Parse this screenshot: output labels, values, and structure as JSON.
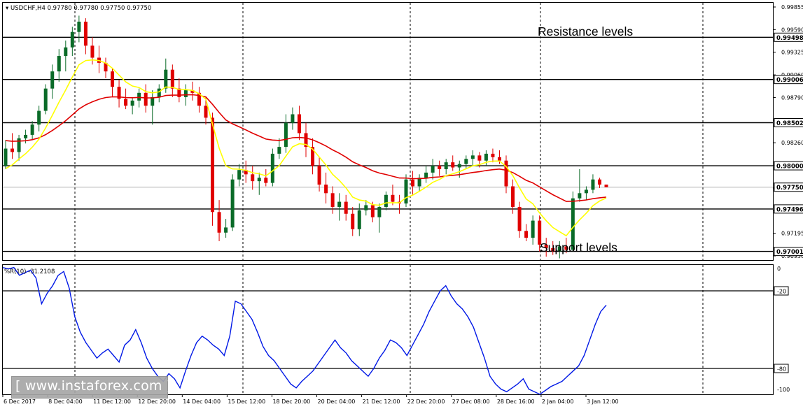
{
  "header": {
    "symbol": "USDCHF,H4",
    "open": "0.97780",
    "high": "0.97780",
    "low": "0.97750",
    "close": "0.97750"
  },
  "annotations": {
    "resistance": "Resistance levels",
    "support": "Support levels"
  },
  "watermark": "[ www.instaforex.com ]",
  "indicator": {
    "name": "%R(10)",
    "value": "-31.2108"
  },
  "colors": {
    "bull_candle": "#0a6b28",
    "bear_candle": "#e00000",
    "ma_fast": "#ffff00",
    "ma_slow": "#e00000",
    "wpr_line": "#0018e6",
    "level_line": "#000000"
  },
  "chart_data": [
    {
      "type": "candlestick",
      "instrument": "USDCHF",
      "timeframe": "H4",
      "y_ticks": [
        "0.99855",
        "0.99590",
        "0.99325",
        "0.99060",
        "0.98790",
        "0.98525",
        "0.98260",
        "0.97995",
        "0.97730",
        "0.97460",
        "0.97195",
        "0.96930"
      ],
      "ylim": [
        0.969,
        0.999
      ],
      "horizontal_levels": [
        {
          "value": 0.99498,
          "label": "0.99498"
        },
        {
          "value": 0.99006,
          "label": "0.99006"
        },
        {
          "value": 0.98502,
          "label": "0.98502"
        },
        {
          "value": 0.98,
          "label": "0.98000"
        },
        {
          "value": 0.97496,
          "label": "0.97496"
        },
        {
          "value": 0.97001,
          "label": "0.97001"
        }
      ],
      "current_price": {
        "value": 0.9775,
        "label": "0.97750"
      },
      "x_labels": [
        "6 Dec 2017",
        "8 Dec 04:00",
        "11 Dec 12:00",
        "12 Dec 20:00",
        "14 Dec 04:00",
        "15 Dec 12:00",
        "18 Dec 20:00",
        "20 Dec 04:00",
        "21 Dec 12:00",
        "22 Dec 20:00",
        "27 Dec 08:00",
        "28 Dec 16:00",
        "2 Jan 04:00",
        "3 Jan 12:00"
      ],
      "ohlc": [
        [
          0.98,
          0.983,
          0.9796,
          0.982
        ],
        [
          0.982,
          0.9838,
          0.9808,
          0.9816
        ],
        [
          0.9816,
          0.9836,
          0.9806,
          0.9832
        ],
        [
          0.9832,
          0.9842,
          0.9826,
          0.9836
        ],
        [
          0.9836,
          0.9852,
          0.983,
          0.9848
        ],
        [
          0.9848,
          0.987,
          0.984,
          0.9864
        ],
        [
          0.9864,
          0.9895,
          0.986,
          0.989
        ],
        [
          0.989,
          0.9918,
          0.9878,
          0.991
        ],
        [
          0.991,
          0.9936,
          0.9898,
          0.9928
        ],
        [
          0.9928,
          0.9946,
          0.991,
          0.9938
        ],
        [
          0.9938,
          0.9962,
          0.9928,
          0.9956
        ],
        [
          0.9956,
          0.9975,
          0.9944,
          0.9968
        ],
        [
          0.9968,
          0.9972,
          0.993,
          0.994
        ],
        [
          0.994,
          0.995,
          0.9918,
          0.9926
        ],
        [
          0.9926,
          0.994,
          0.9908,
          0.992
        ],
        [
          0.992,
          0.9926,
          0.9902,
          0.991
        ],
        [
          0.991,
          0.9914,
          0.988,
          0.9892
        ],
        [
          0.9892,
          0.99,
          0.9868,
          0.9878
        ],
        [
          0.9878,
          0.989,
          0.9866,
          0.987
        ],
        [
          0.987,
          0.988,
          0.986,
          0.9876
        ],
        [
          0.9876,
          0.989,
          0.9868,
          0.9885
        ],
        [
          0.9885,
          0.9895,
          0.9862,
          0.987
        ],
        [
          0.987,
          0.9888,
          0.9848,
          0.988
        ],
        [
          0.988,
          0.9895,
          0.9874,
          0.989
        ],
        [
          0.989,
          0.9925,
          0.9885,
          0.9912
        ],
        [
          0.9912,
          0.9918,
          0.988,
          0.989
        ],
        [
          0.989,
          0.9902,
          0.9874,
          0.988
        ],
        [
          0.988,
          0.9895,
          0.987,
          0.9888
        ],
        [
          0.9888,
          0.9898,
          0.9876,
          0.9885
        ],
        [
          0.9885,
          0.9892,
          0.9862,
          0.987
        ],
        [
          0.987,
          0.988,
          0.9848,
          0.9856
        ],
        [
          0.9856,
          0.9862,
          0.973,
          0.9746
        ],
        [
          0.9746,
          0.976,
          0.9712,
          0.9722
        ],
        [
          0.9722,
          0.9738,
          0.9716,
          0.9728
        ],
        [
          0.9728,
          0.979,
          0.9724,
          0.9784
        ],
        [
          0.9784,
          0.9802,
          0.9776,
          0.9795
        ],
        [
          0.9795,
          0.9806,
          0.978,
          0.979
        ],
        [
          0.979,
          0.98,
          0.9772,
          0.9782
        ],
        [
          0.9782,
          0.9792,
          0.9766,
          0.9786
        ],
        [
          0.9786,
          0.9796,
          0.9776,
          0.978
        ],
        [
          0.978,
          0.982,
          0.9776,
          0.9814
        ],
        [
          0.9814,
          0.9832,
          0.9808,
          0.9822
        ],
        [
          0.9822,
          0.986,
          0.9815,
          0.985
        ],
        [
          0.985,
          0.9868,
          0.9842,
          0.986
        ],
        [
          0.986,
          0.987,
          0.983,
          0.9838
        ],
        [
          0.9838,
          0.985,
          0.981,
          0.9822
        ],
        [
          0.9822,
          0.9832,
          0.979,
          0.98
        ],
        [
          0.98,
          0.981,
          0.977,
          0.9778
        ],
        [
          0.9778,
          0.9792,
          0.9756,
          0.9768
        ],
        [
          0.9768,
          0.9776,
          0.9744,
          0.9752
        ],
        [
          0.9752,
          0.9768,
          0.9736,
          0.9758
        ],
        [
          0.9758,
          0.9766,
          0.9736,
          0.9744
        ],
        [
          0.9744,
          0.9752,
          0.9718,
          0.9726
        ],
        [
          0.9726,
          0.9756,
          0.9718,
          0.9748
        ],
        [
          0.9748,
          0.976,
          0.9742,
          0.9754
        ],
        [
          0.9754,
          0.9758,
          0.9734,
          0.974
        ],
        [
          0.974,
          0.9756,
          0.9722,
          0.9752
        ],
        [
          0.9752,
          0.977,
          0.9748,
          0.9766
        ],
        [
          0.9766,
          0.9778,
          0.9754,
          0.9758
        ],
        [
          0.9758,
          0.9766,
          0.9744,
          0.9756
        ],
        [
          0.9756,
          0.979,
          0.9752,
          0.9784
        ],
        [
          0.9784,
          0.9794,
          0.9766,
          0.9776
        ],
        [
          0.9776,
          0.979,
          0.977,
          0.9786
        ],
        [
          0.9786,
          0.98,
          0.978,
          0.9792
        ],
        [
          0.9792,
          0.9808,
          0.9784,
          0.98
        ],
        [
          0.98,
          0.9806,
          0.9788,
          0.9796
        ],
        [
          0.9796,
          0.9808,
          0.979,
          0.9804
        ],
        [
          0.9804,
          0.9812,
          0.9794,
          0.9798
        ],
        [
          0.9798,
          0.9806,
          0.9786,
          0.9802
        ],
        [
          0.9802,
          0.9812,
          0.9796,
          0.9808
        ],
        [
          0.9808,
          0.9818,
          0.98,
          0.9812
        ],
        [
          0.9812,
          0.9816,
          0.9798,
          0.9806
        ],
        [
          0.9806,
          0.9818,
          0.98,
          0.9814
        ],
        [
          0.9814,
          0.982,
          0.9804,
          0.981
        ],
        [
          0.981,
          0.9818,
          0.9802,
          0.9806
        ],
        [
          0.9806,
          0.9812,
          0.9768,
          0.9776
        ],
        [
          0.9776,
          0.9784,
          0.9744,
          0.9752
        ],
        [
          0.9752,
          0.9758,
          0.9716,
          0.9724
        ],
        [
          0.9724,
          0.9732,
          0.9712,
          0.9716
        ],
        [
          0.9716,
          0.9742,
          0.9708,
          0.9736
        ],
        [
          0.9736,
          0.9742,
          0.97,
          0.9708
        ],
        [
          0.9708,
          0.9716,
          0.9694,
          0.9704
        ],
        [
          0.9704,
          0.9712,
          0.9696,
          0.97
        ],
        [
          0.97,
          0.9712,
          0.9692,
          0.9706
        ],
        [
          0.9706,
          0.9716,
          0.9698,
          0.9702
        ],
        [
          0.9702,
          0.977,
          0.97,
          0.9762
        ],
        [
          0.9762,
          0.9796,
          0.9758,
          0.9768
        ],
        [
          0.9768,
          0.9776,
          0.976,
          0.9772
        ],
        [
          0.9772,
          0.979,
          0.9768,
          0.9784
        ],
        [
          0.9784,
          0.9786,
          0.9774,
          0.9778
        ],
        [
          0.9778,
          0.9778,
          0.9775,
          0.9775
        ]
      ]
    },
    {
      "type": "line",
      "name": "%R(10)",
      "y_ticks": [
        "0",
        "-20",
        "-80",
        "-100"
      ],
      "ylim": [
        -100,
        0
      ],
      "levels": [
        -20,
        -80
      ],
      "values": [
        -2,
        -3,
        -2,
        -8,
        -6,
        -4,
        -10,
        -30,
        -22,
        -16,
        -8,
        -5,
        -18,
        -40,
        -52,
        -60,
        -66,
        -72,
        -68,
        -65,
        -70,
        -75,
        -62,
        -58,
        -50,
        -60,
        -72,
        -80,
        -86,
        -90,
        -84,
        -88,
        -95,
        -82,
        -70,
        -60,
        -55,
        -58,
        -62,
        -65,
        -70,
        -55,
        -28,
        -30,
        -36,
        -42,
        -52,
        -63,
        -70,
        -74,
        -80,
        -86,
        -92,
        -95,
        -90,
        -86,
        -82,
        -76,
        -70,
        -64,
        -58,
        -64,
        -68,
        -74,
        -78,
        -82,
        -86,
        -80,
        -72,
        -66,
        -58,
        -60,
        -64,
        -70,
        -62,
        -54,
        -46,
        -36,
        -28,
        -20,
        -16,
        -24,
        -30,
        -34,
        -40,
        -48,
        -60,
        -72,
        -86,
        -92,
        -96,
        -98,
        -95,
        -92,
        -88,
        -96,
        -98,
        -100,
        -97,
        -94,
        -92,
        -90,
        -86,
        -82,
        -78,
        -70,
        -58,
        -46,
        -36,
        -31
      ]
    }
  ]
}
